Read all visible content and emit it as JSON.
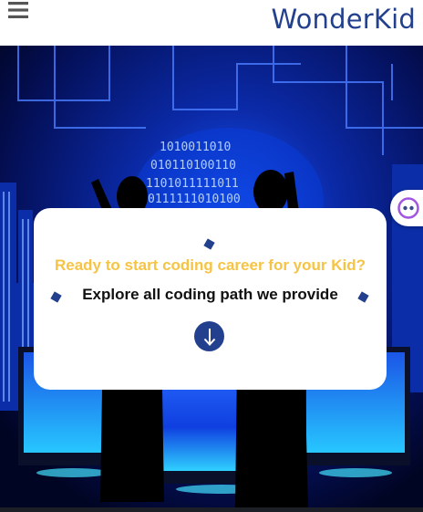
{
  "header": {
    "brand": "WonderKid",
    "menu_icon": "hamburger-menu-icon"
  },
  "hero": {
    "title": "Ready to start coding career for your Kid?",
    "subtitle": "Explore all coding path we provide",
    "scroll_icon": "arrow-down-icon",
    "background_image": "kids-silhouettes-binary-data-screens"
  },
  "chat_widget": {
    "icon": "chat-bot-face-icon"
  },
  "colors": {
    "brand": "#23408e",
    "title_yellow": "#f6c445",
    "hero_dark": "#020a38"
  }
}
